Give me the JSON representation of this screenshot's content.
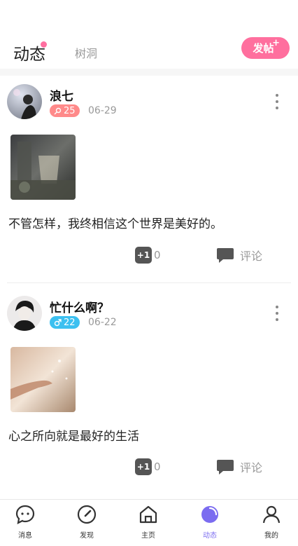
{
  "header": {
    "tabs": [
      {
        "label": "动态",
        "active": true
      },
      {
        "label": "树洞",
        "active": false
      }
    ],
    "post_button": "发帖",
    "post_button_mark": "+"
  },
  "posts": [
    {
      "username": "浪七",
      "badge_value": "25",
      "badge_icon": "female-icon",
      "badge_color": "#ff8a8a",
      "date": "06-29",
      "content": "不管怎样，我终相信这个世界是美好的。",
      "plus_label": "+1",
      "plus_count": "0",
      "comment_label": "评论"
    },
    {
      "username": "忙什么啊？",
      "badge_value": "22",
      "badge_icon": "male-icon",
      "badge_color": "#3cc0f0",
      "date": "06-22",
      "content": "心之所向就是最好的生活",
      "plus_label": "+1",
      "plus_count": "0",
      "comment_label": "评论"
    }
  ],
  "tabbar": {
    "items": [
      {
        "label": "消息",
        "icon": "message-icon",
        "active": false
      },
      {
        "label": "发现",
        "icon": "compass-icon",
        "active": false
      },
      {
        "label": "主页",
        "icon": "home-icon",
        "active": false
      },
      {
        "label": "动态",
        "icon": "moments-icon",
        "active": true
      },
      {
        "label": "我的",
        "icon": "profile-icon",
        "active": false
      }
    ],
    "active_color": "#7b6cf0"
  }
}
